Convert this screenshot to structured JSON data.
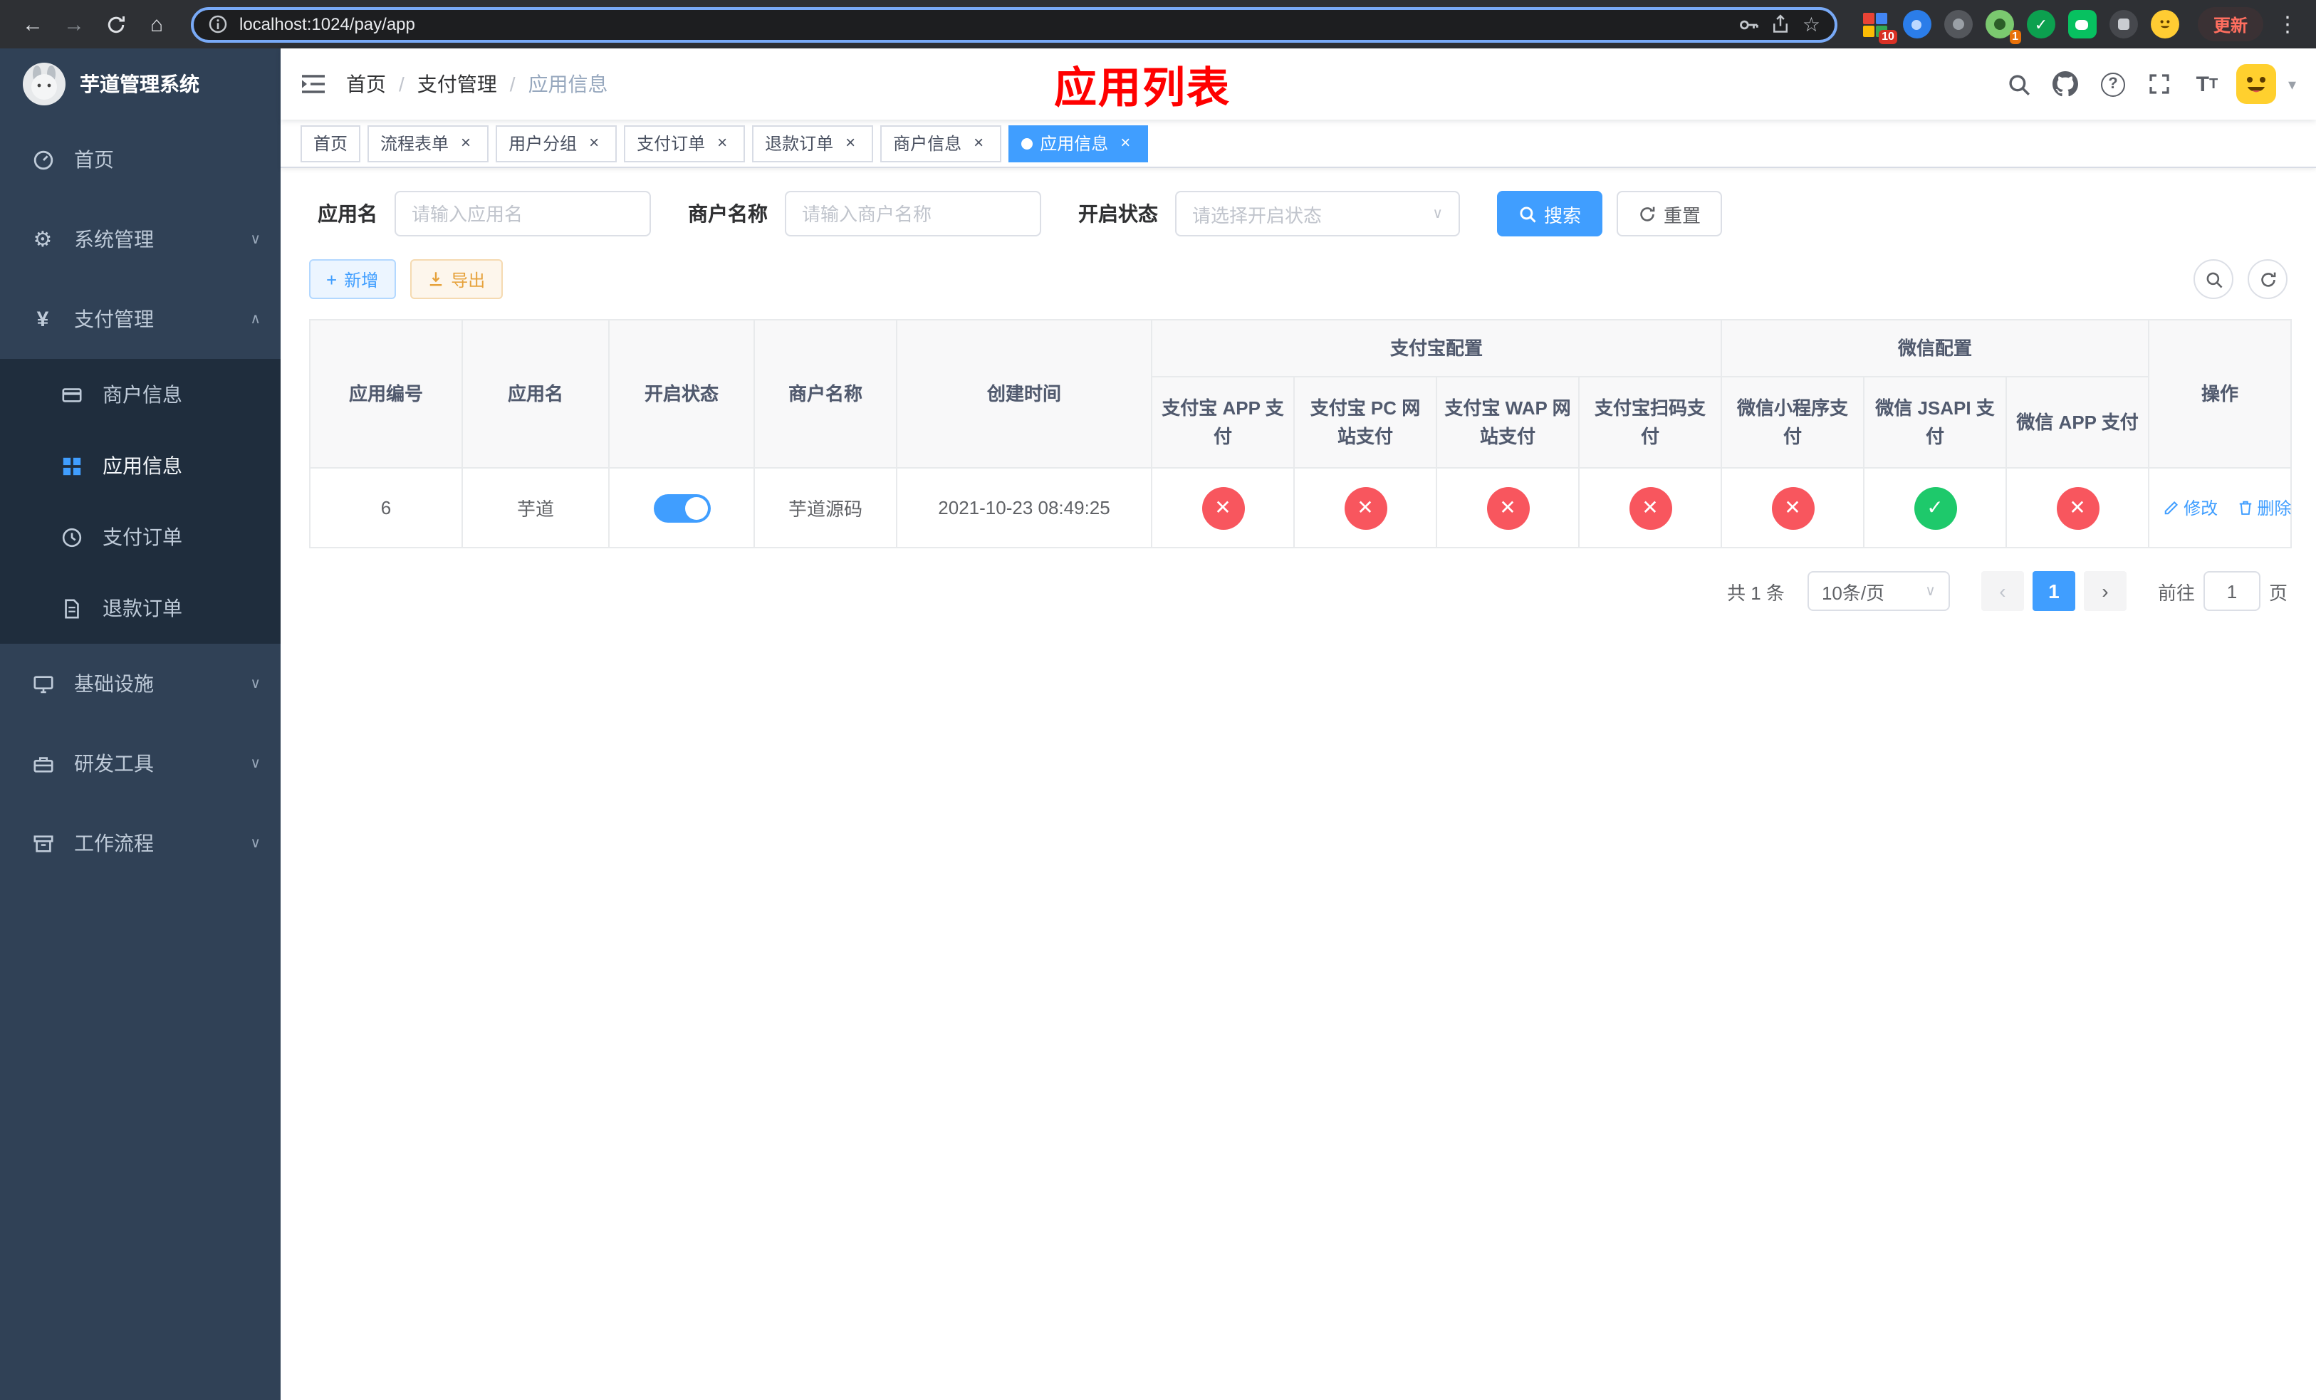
{
  "colors": {
    "accent": "#409eff",
    "success": "#1ec96b",
    "danger": "#f8565e",
    "title_red": "#ff0000"
  },
  "browser": {
    "url": "localhost:1024/pay/app",
    "update_label": "更新",
    "ext_badge_1": "10",
    "ext_badge_2": "1"
  },
  "sidebar": {
    "logo_title": "芋道管理系统",
    "items": [
      {
        "label": "首页"
      },
      {
        "label": "系统管理"
      },
      {
        "label": "支付管理",
        "children": [
          {
            "label": "商户信息"
          },
          {
            "label": "应用信息"
          },
          {
            "label": "支付订单"
          },
          {
            "label": "退款订单"
          }
        ]
      },
      {
        "label": "基础设施"
      },
      {
        "label": "研发工具"
      },
      {
        "label": "工作流程"
      }
    ]
  },
  "header": {
    "breadcrumb": [
      "首页",
      "支付管理",
      "应用信息"
    ],
    "page_title": "应用列表"
  },
  "tabs": [
    {
      "label": "首页"
    },
    {
      "label": "流程表单"
    },
    {
      "label": "用户分组"
    },
    {
      "label": "支付订单"
    },
    {
      "label": "退款订单"
    },
    {
      "label": "商户信息"
    },
    {
      "label": "应用信息"
    }
  ],
  "filters": {
    "app_name_label": "应用名",
    "app_name_placeholder": "请输入应用名",
    "merchant_label": "商户名称",
    "merchant_placeholder": "请输入商户名称",
    "status_label": "开启状态",
    "status_placeholder": "请选择开启状态",
    "search_label": "搜索",
    "reset_label": "重置"
  },
  "toolbar": {
    "add_label": "新增",
    "export_label": "导出"
  },
  "table": {
    "group_alipay": "支付宝配置",
    "group_wechat": "微信配置",
    "columns": [
      "应用编号",
      "应用名",
      "开启状态",
      "商户名称",
      "创建时间",
      "支付宝 APP 支付",
      "支付宝 PC 网站支付",
      "支付宝 WAP 网站支付",
      "支付宝扫码支付",
      "微信小程序支付",
      "微信 JSAPI 支付",
      "微信 APP 支付",
      "操作"
    ],
    "rows": [
      {
        "id": "6",
        "name": "芋道",
        "enabled": true,
        "merchant": "芋道源码",
        "created": "2021-10-23 08:49:25",
        "configs": [
          "no",
          "no",
          "no",
          "no",
          "no",
          "yes",
          "no"
        ],
        "actions": [
          "修改",
          "删除"
        ]
      }
    ]
  },
  "pagination": {
    "total": "共 1 条",
    "page_size": "10条/页",
    "page": "1",
    "goto_label": "前往",
    "goto_value": "1",
    "goto_unit": "页"
  }
}
